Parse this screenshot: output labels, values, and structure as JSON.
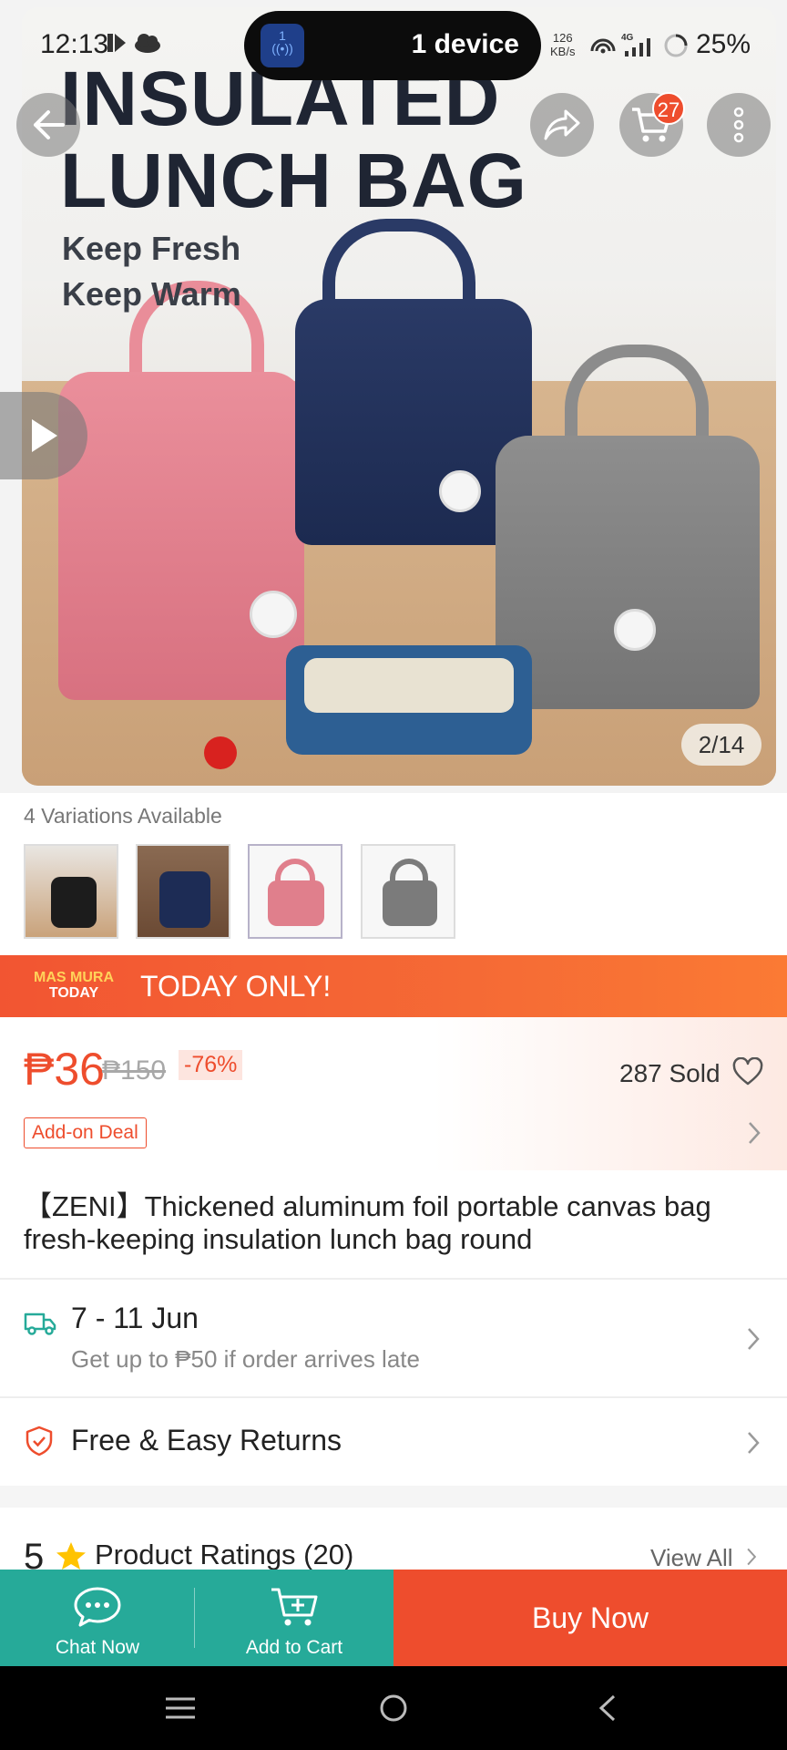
{
  "status_bar": {
    "time": "12:13",
    "island_label": "1 device",
    "island_icon_badge": "1",
    "speed_value": "126",
    "speed_unit": "KB/s",
    "network": "4G",
    "battery": "25%"
  },
  "hero": {
    "title_line1": "INSULATED",
    "title_line2": "LUNCH BAG",
    "subtitle_line1": "Keep Fresh",
    "subtitle_line2": "Keep Warm",
    "image_counter": "2/14",
    "cart_badge": "27"
  },
  "variations": {
    "label": "4 Variations Available",
    "items": [
      {
        "color": "black",
        "hex": "#1c1c1c",
        "selected": false
      },
      {
        "color": "navy",
        "hex": "#1d2c55",
        "selected": false
      },
      {
        "color": "pink",
        "hex": "#e07f8c",
        "selected": true
      },
      {
        "color": "gray",
        "hex": "#7b7b7b",
        "selected": false
      }
    ]
  },
  "promo": {
    "logo_line1": "MAS MURA",
    "logo_line2": "TODAY",
    "text": "TODAY ONLY!"
  },
  "price": {
    "current": "₱36",
    "original": "₱150",
    "discount": "-76%",
    "sold": "287 Sold",
    "tag": "Add-on Deal"
  },
  "product": {
    "title": "【ZENI】Thickened aluminum foil portable canvas bag fresh-keeping insulation lunch bag round"
  },
  "shipping": {
    "dates": "7 - 11 Jun",
    "note": "Get up to ₱50 if order arrives late"
  },
  "returns": {
    "label": "Free & Easy Returns"
  },
  "ratings": {
    "value": "5",
    "label": "Product Ratings (20)",
    "view_all": "View All"
  },
  "actions": {
    "chat": "Chat Now",
    "add_to_cart": "Add to Cart",
    "buy_now": "Buy Now"
  },
  "colors": {
    "brand": "#ee4d2d",
    "teal": "#26aa99",
    "promo_orange": "#f56a35"
  }
}
